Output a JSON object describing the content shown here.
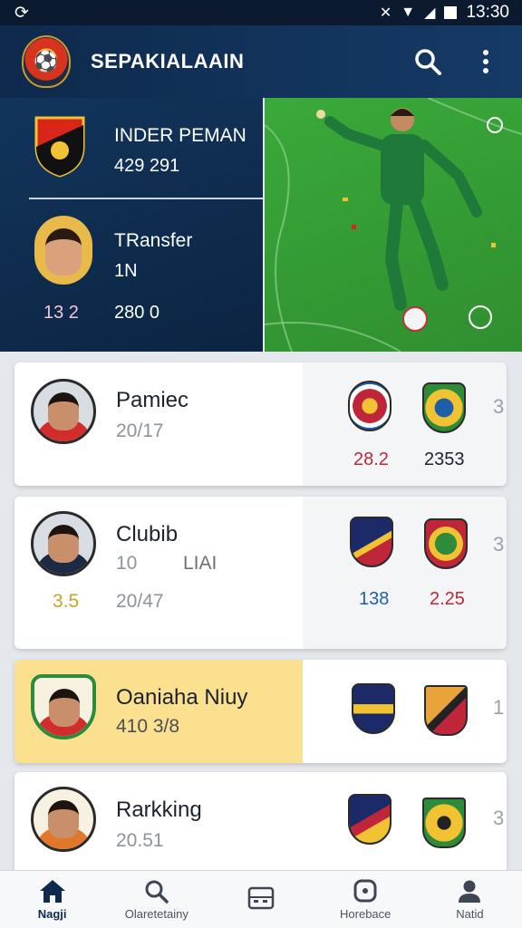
{
  "status": {
    "time": "13:30"
  },
  "app": {
    "title": "SEPAKIALAAIN"
  },
  "hero": {
    "top_label": "INDER PEMAN",
    "top_value": "429 291",
    "bottom_label": "TRansfer",
    "bottom_value": "1N",
    "left_num": "13 2",
    "right_num": "280 0"
  },
  "cards": [
    {
      "name": "Pamiec",
      "sub1": "20/17",
      "sub2": "",
      "sub3": "",
      "sub4": "",
      "score1": "28.2",
      "score2": "2353",
      "rank": "3"
    },
    {
      "name": "Clubib",
      "sub1": "10",
      "sub2": "LIAI",
      "sub3": "3.5",
      "sub4": "20/47",
      "score1": "138",
      "score2": "2.25",
      "rank": "3"
    },
    {
      "name": "Oaniaha Niuy",
      "sub1": "410 3/8",
      "sub2": "",
      "sub3": "",
      "sub4": "",
      "score1": "",
      "score2": "",
      "rank": "1"
    },
    {
      "name": "Rarkking",
      "sub1": "20.51",
      "sub2": "",
      "sub3": "",
      "sub4": "",
      "score1": "",
      "score2": "",
      "rank": "3"
    }
  ],
  "nav": [
    {
      "label": "Nagji",
      "icon": "home-icon"
    },
    {
      "label": "Olaretetainy",
      "icon": "search-icon"
    },
    {
      "label": "",
      "icon": "card-icon"
    },
    {
      "label": "Horebace",
      "icon": "watch-icon"
    },
    {
      "label": "Natid",
      "icon": "profile-icon"
    }
  ],
  "colors": {
    "app_bar": "#0e2a4d",
    "highlight": "#fbe08f",
    "score_red": "#c0263a",
    "score_blue": "#1f5fa8",
    "score_gold": "#c9a227"
  }
}
